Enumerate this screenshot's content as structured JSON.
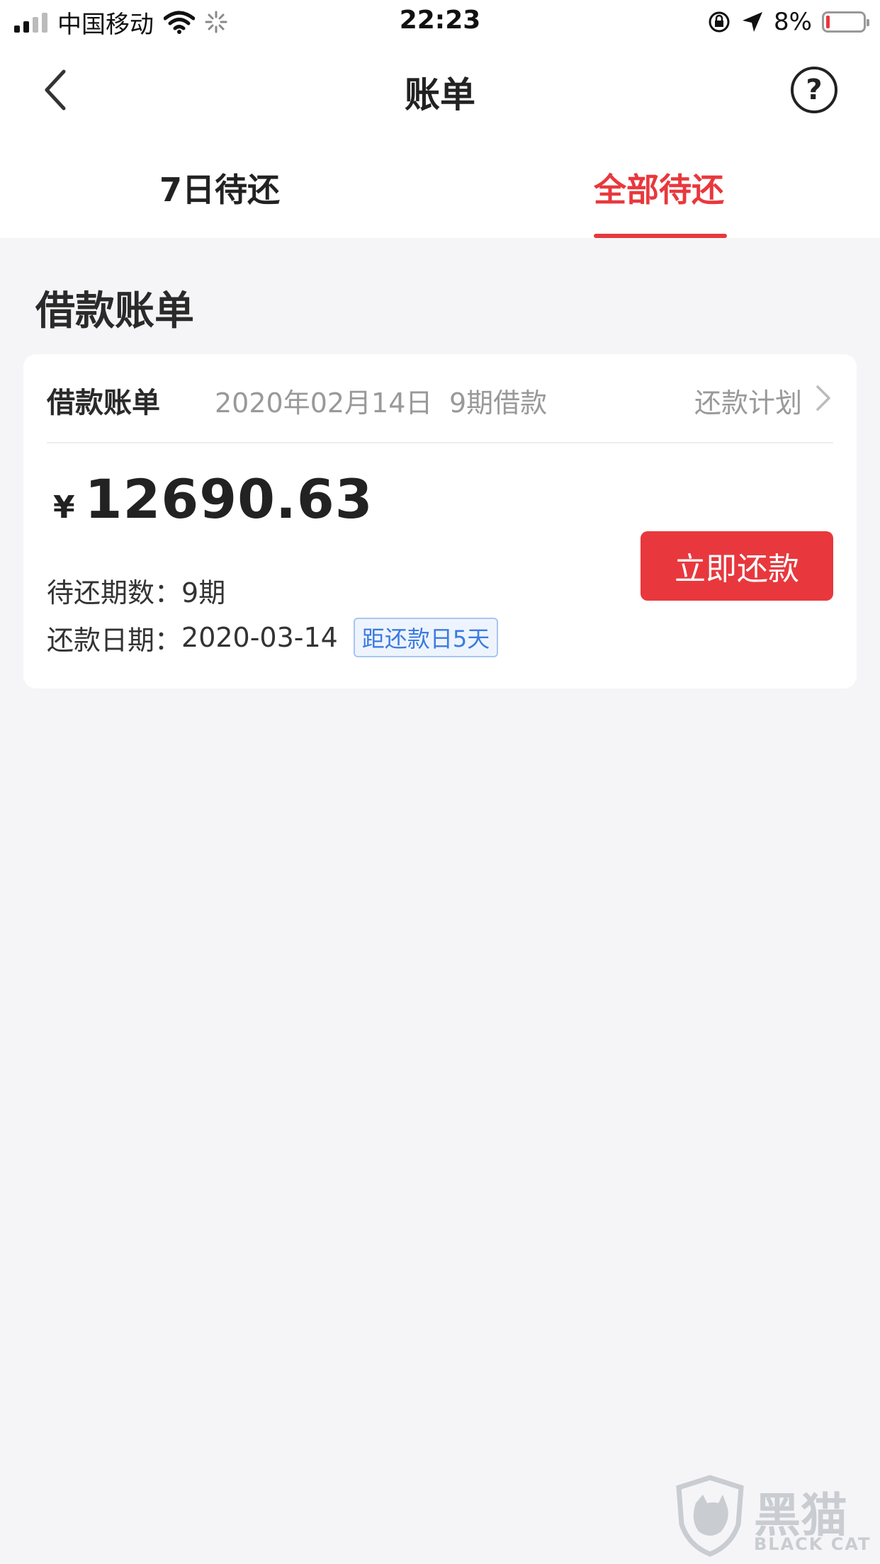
{
  "status_bar": {
    "carrier": "中国移动",
    "time": "22:23",
    "battery_percent": "8%",
    "icons": [
      "signal-icon",
      "wifi-icon",
      "loading-icon",
      "rotation-lock-icon",
      "location-icon",
      "battery-icon"
    ]
  },
  "nav": {
    "title": "账单",
    "back_icon": "chevron-left-icon",
    "help_label": "?"
  },
  "tabs": [
    {
      "label": "7日待还",
      "active": false
    },
    {
      "label": "全部待还",
      "active": true
    }
  ],
  "section_title": "借款账单",
  "card": {
    "title": "借款账单",
    "date": "2020年02月14日",
    "terms": "9期借款",
    "plan_link": "还款计划",
    "currency": "¥",
    "amount": "12690.63",
    "remaining_label": "待还期数：",
    "remaining_value": "9期",
    "due_label": "还款日期：",
    "due_value": "2020-03-14",
    "due_tag": "距还款日5天",
    "pay_button": "立即还款"
  },
  "colors": {
    "accent": "#e8383d",
    "tag_blue": "#3b7be0",
    "background": "#f5f5f7"
  },
  "watermark": {
    "text": "黑猫",
    "sub": "BLACK CAT"
  }
}
